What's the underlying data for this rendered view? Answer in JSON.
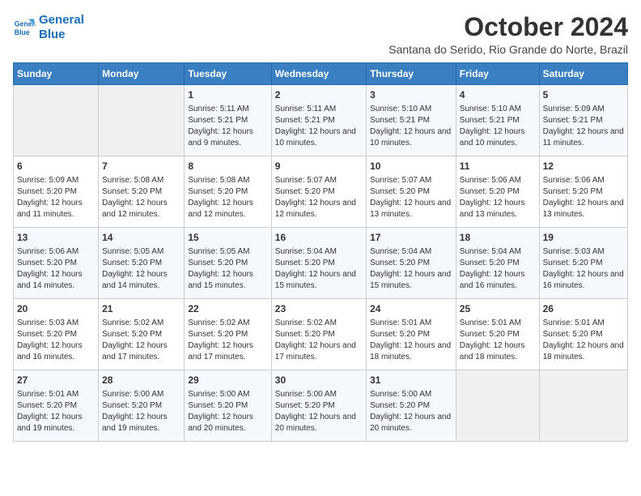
{
  "logo": {
    "line1": "General",
    "line2": "Blue"
  },
  "title": "October 2024",
  "subtitle": "Santana do Serido, Rio Grande do Norte, Brazil",
  "weekdays": [
    "Sunday",
    "Monday",
    "Tuesday",
    "Wednesday",
    "Thursday",
    "Friday",
    "Saturday"
  ],
  "weeks": [
    [
      {
        "day": "",
        "empty": true
      },
      {
        "day": "",
        "empty": true
      },
      {
        "day": "1",
        "sunrise": "Sunrise: 5:11 AM",
        "sunset": "Sunset: 5:21 PM",
        "daylight": "Daylight: 12 hours and 9 minutes."
      },
      {
        "day": "2",
        "sunrise": "Sunrise: 5:11 AM",
        "sunset": "Sunset: 5:21 PM",
        "daylight": "Daylight: 12 hours and 10 minutes."
      },
      {
        "day": "3",
        "sunrise": "Sunrise: 5:10 AM",
        "sunset": "Sunset: 5:21 PM",
        "daylight": "Daylight: 12 hours and 10 minutes."
      },
      {
        "day": "4",
        "sunrise": "Sunrise: 5:10 AM",
        "sunset": "Sunset: 5:21 PM",
        "daylight": "Daylight: 12 hours and 10 minutes."
      },
      {
        "day": "5",
        "sunrise": "Sunrise: 5:09 AM",
        "sunset": "Sunset: 5:21 PM",
        "daylight": "Daylight: 12 hours and 11 minutes."
      }
    ],
    [
      {
        "day": "6",
        "sunrise": "Sunrise: 5:09 AM",
        "sunset": "Sunset: 5:20 PM",
        "daylight": "Daylight: 12 hours and 11 minutes."
      },
      {
        "day": "7",
        "sunrise": "Sunrise: 5:08 AM",
        "sunset": "Sunset: 5:20 PM",
        "daylight": "Daylight: 12 hours and 12 minutes."
      },
      {
        "day": "8",
        "sunrise": "Sunrise: 5:08 AM",
        "sunset": "Sunset: 5:20 PM",
        "daylight": "Daylight: 12 hours and 12 minutes."
      },
      {
        "day": "9",
        "sunrise": "Sunrise: 5:07 AM",
        "sunset": "Sunset: 5:20 PM",
        "daylight": "Daylight: 12 hours and 12 minutes."
      },
      {
        "day": "10",
        "sunrise": "Sunrise: 5:07 AM",
        "sunset": "Sunset: 5:20 PM",
        "daylight": "Daylight: 12 hours and 13 minutes."
      },
      {
        "day": "11",
        "sunrise": "Sunrise: 5:06 AM",
        "sunset": "Sunset: 5:20 PM",
        "daylight": "Daylight: 12 hours and 13 minutes."
      },
      {
        "day": "12",
        "sunrise": "Sunrise: 5:06 AM",
        "sunset": "Sunset: 5:20 PM",
        "daylight": "Daylight: 12 hours and 13 minutes."
      }
    ],
    [
      {
        "day": "13",
        "sunrise": "Sunrise: 5:06 AM",
        "sunset": "Sunset: 5:20 PM",
        "daylight": "Daylight: 12 hours and 14 minutes."
      },
      {
        "day": "14",
        "sunrise": "Sunrise: 5:05 AM",
        "sunset": "Sunset: 5:20 PM",
        "daylight": "Daylight: 12 hours and 14 minutes."
      },
      {
        "day": "15",
        "sunrise": "Sunrise: 5:05 AM",
        "sunset": "Sunset: 5:20 PM",
        "daylight": "Daylight: 12 hours and 15 minutes."
      },
      {
        "day": "16",
        "sunrise": "Sunrise: 5:04 AM",
        "sunset": "Sunset: 5:20 PM",
        "daylight": "Daylight: 12 hours and 15 minutes."
      },
      {
        "day": "17",
        "sunrise": "Sunrise: 5:04 AM",
        "sunset": "Sunset: 5:20 PM",
        "daylight": "Daylight: 12 hours and 15 minutes."
      },
      {
        "day": "18",
        "sunrise": "Sunrise: 5:04 AM",
        "sunset": "Sunset: 5:20 PM",
        "daylight": "Daylight: 12 hours and 16 minutes."
      },
      {
        "day": "19",
        "sunrise": "Sunrise: 5:03 AM",
        "sunset": "Sunset: 5:20 PM",
        "daylight": "Daylight: 12 hours and 16 minutes."
      }
    ],
    [
      {
        "day": "20",
        "sunrise": "Sunrise: 5:03 AM",
        "sunset": "Sunset: 5:20 PM",
        "daylight": "Daylight: 12 hours and 16 minutes."
      },
      {
        "day": "21",
        "sunrise": "Sunrise: 5:02 AM",
        "sunset": "Sunset: 5:20 PM",
        "daylight": "Daylight: 12 hours and 17 minutes."
      },
      {
        "day": "22",
        "sunrise": "Sunrise: 5:02 AM",
        "sunset": "Sunset: 5:20 PM",
        "daylight": "Daylight: 12 hours and 17 minutes."
      },
      {
        "day": "23",
        "sunrise": "Sunrise: 5:02 AM",
        "sunset": "Sunset: 5:20 PM",
        "daylight": "Daylight: 12 hours and 17 minutes."
      },
      {
        "day": "24",
        "sunrise": "Sunrise: 5:01 AM",
        "sunset": "Sunset: 5:20 PM",
        "daylight": "Daylight: 12 hours and 18 minutes."
      },
      {
        "day": "25",
        "sunrise": "Sunrise: 5:01 AM",
        "sunset": "Sunset: 5:20 PM",
        "daylight": "Daylight: 12 hours and 18 minutes."
      },
      {
        "day": "26",
        "sunrise": "Sunrise: 5:01 AM",
        "sunset": "Sunset: 5:20 PM",
        "daylight": "Daylight: 12 hours and 18 minutes."
      }
    ],
    [
      {
        "day": "27",
        "sunrise": "Sunrise: 5:01 AM",
        "sunset": "Sunset: 5:20 PM",
        "daylight": "Daylight: 12 hours and 19 minutes."
      },
      {
        "day": "28",
        "sunrise": "Sunrise: 5:00 AM",
        "sunset": "Sunset: 5:20 PM",
        "daylight": "Daylight: 12 hours and 19 minutes."
      },
      {
        "day": "29",
        "sunrise": "Sunrise: 5:00 AM",
        "sunset": "Sunset: 5:20 PM",
        "daylight": "Daylight: 12 hours and 20 minutes."
      },
      {
        "day": "30",
        "sunrise": "Sunrise: 5:00 AM",
        "sunset": "Sunset: 5:20 PM",
        "daylight": "Daylight: 12 hours and 20 minutes."
      },
      {
        "day": "31",
        "sunrise": "Sunrise: 5:00 AM",
        "sunset": "Sunset: 5:20 PM",
        "daylight": "Daylight: 12 hours and 20 minutes."
      },
      {
        "day": "",
        "empty": true
      },
      {
        "day": "",
        "empty": true
      }
    ]
  ]
}
